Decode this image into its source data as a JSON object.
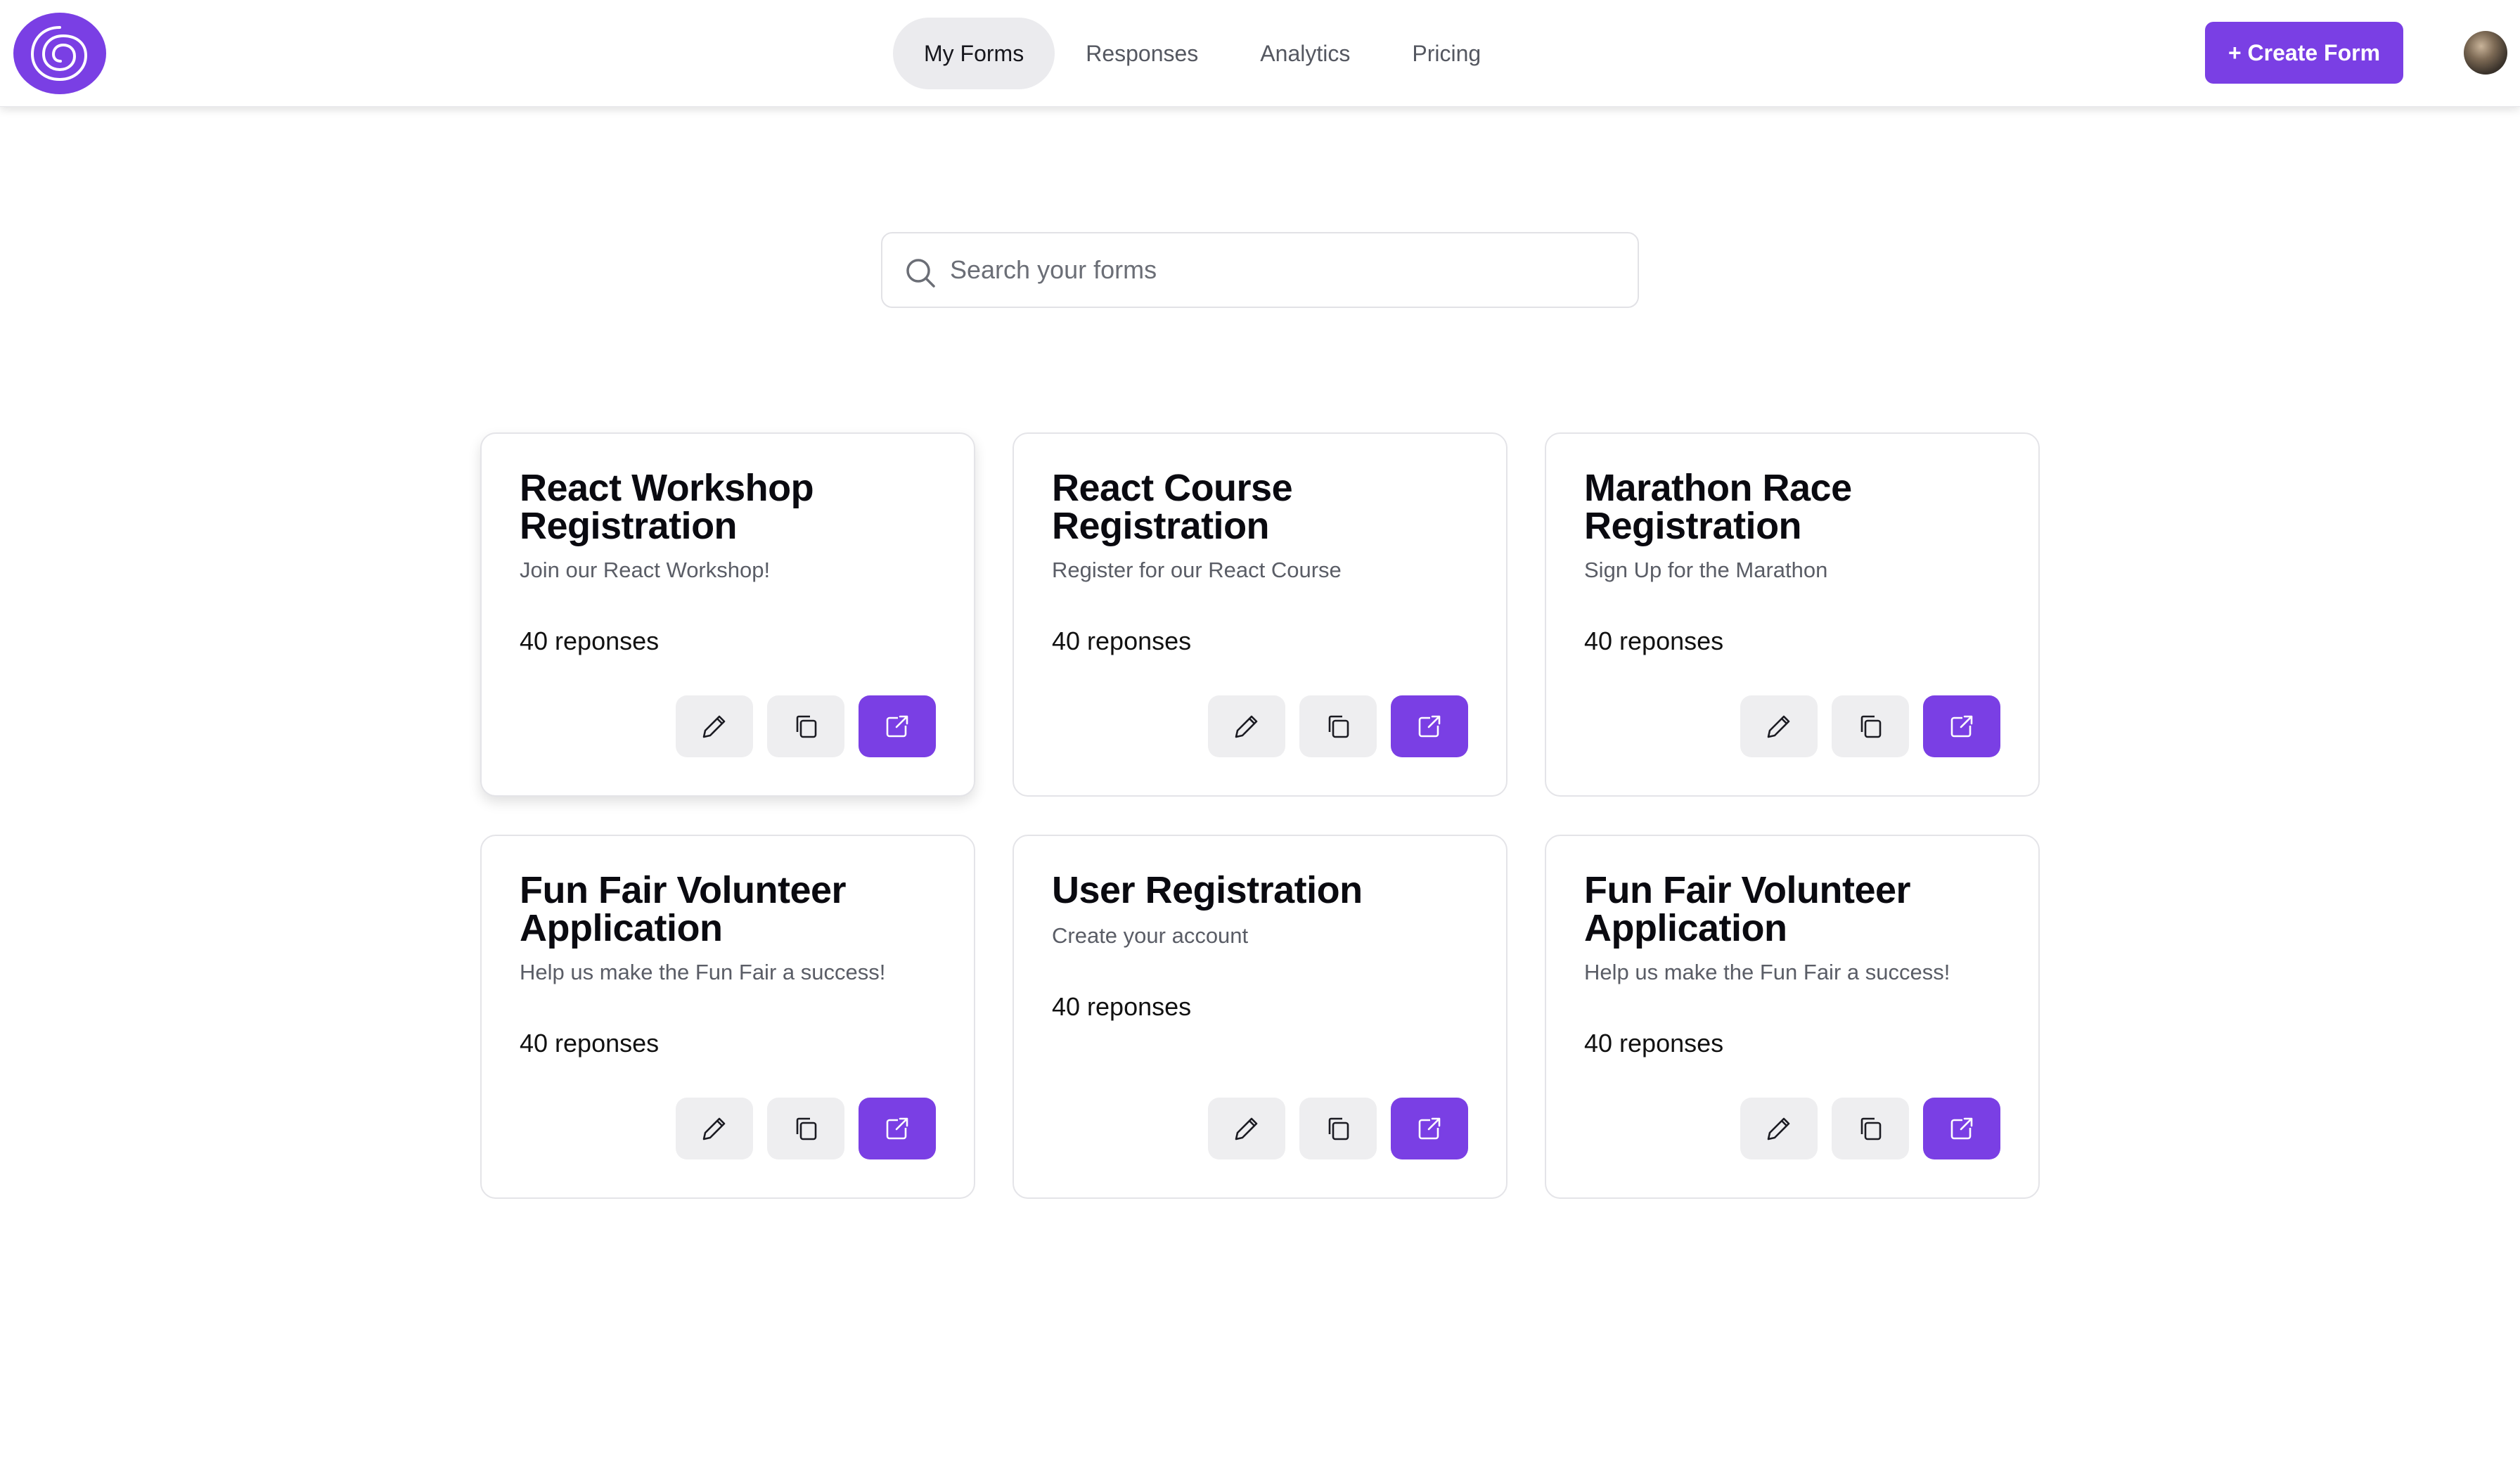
{
  "nav": {
    "items": [
      {
        "label": "My Forms",
        "active": true
      },
      {
        "label": "Responses",
        "active": false
      },
      {
        "label": "Analytics",
        "active": false
      },
      {
        "label": "Pricing",
        "active": false
      }
    ],
    "create_label": "+ Create Form",
    "logo_icon": "spiral-logo-icon",
    "avatar": "user-avatar"
  },
  "search": {
    "placeholder": "Search your forms",
    "value": ""
  },
  "colors": {
    "accent": "#7a3fe4",
    "nav_active_bg": "#ebebee",
    "action_bg": "#eeeef0"
  },
  "forms": [
    {
      "title": "React Workshop Registration",
      "description": "Join our React Workshop!",
      "responses": "40 reponses"
    },
    {
      "title": "React Course Registration",
      "description": "Register for our React Course",
      "responses": "40 reponses"
    },
    {
      "title": "Marathon Race Registration",
      "description": "Sign Up for the Marathon",
      "responses": "40 reponses"
    },
    {
      "title": "Fun Fair Volunteer Application",
      "description": "Help us make the Fun Fair a success!",
      "responses": "40 reponses"
    },
    {
      "title": "User Registration",
      "description": "Create your account",
      "responses": "40 reponses"
    },
    {
      "title": "Fun Fair Volunteer Application",
      "description": "Help us make the Fun Fair a success!",
      "responses": "40 reponses"
    }
  ],
  "card_actions": {
    "edit_icon": "pencil-icon",
    "duplicate_icon": "copy-icon",
    "open_icon": "external-link-icon"
  }
}
